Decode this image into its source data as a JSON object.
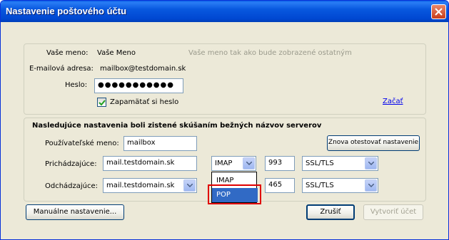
{
  "window": {
    "title": "Nastavenie poštového účtu"
  },
  "account": {
    "name_label": "Vaše meno:",
    "name_value": "Vaše Meno",
    "name_hint": "Vaše meno tak ako bude zobrazené ostatným",
    "email_label": "E-mailová adresa:",
    "email_value": "mailbox@testdomain.sk",
    "password_label": "Heslo:",
    "password_value": "●●●●●●●●●●●",
    "remember_label": "Zapamätať si heslo",
    "remember_checked": true,
    "start_link": "Začať"
  },
  "servers": {
    "heading": "Nasledujúce nastavenia boli zistené skúšaním bežných názvov serverov",
    "username_label": "Používateľské meno:",
    "username_value": "mailbox",
    "retest_button": "Znova otestovať nastavenie",
    "incoming_label": "Prichádzajúce:",
    "incoming_server": "mail.testdomain.sk",
    "incoming_protocol": "IMAP",
    "incoming_port": "993",
    "incoming_security": "SSL/TLS",
    "outgoing_label": "Odchádzajúce:",
    "outgoing_server": "mail.testdomain.sk",
    "outgoing_port": "465",
    "outgoing_security": "SSL/TLS"
  },
  "protocol_dropdown": {
    "options": [
      "IMAP",
      "POP"
    ],
    "highlighted": "POP"
  },
  "footer": {
    "manual_button": "Manuálne nastavenie...",
    "cancel_button": "Zrušiť",
    "create_button": "Vytvoriť účet"
  },
  "colors": {
    "titlebar": "#0858df",
    "dialog_bg": "#ece9d8",
    "selection": "#316ac5",
    "highlight_frame": "#e00000",
    "link": "#0000ee"
  }
}
